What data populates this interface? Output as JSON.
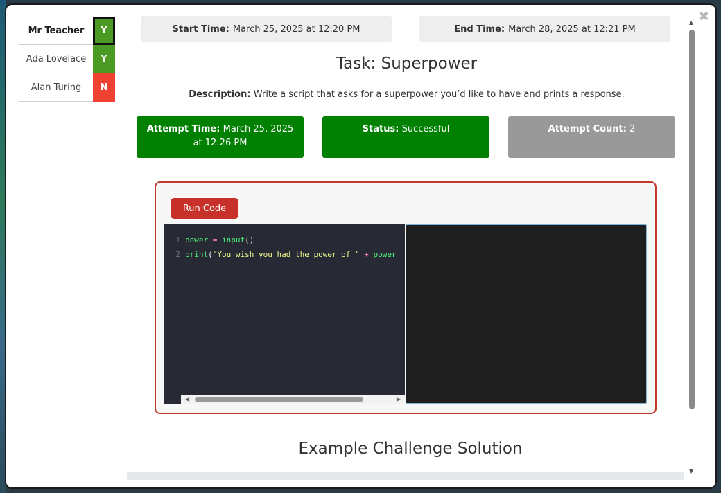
{
  "students": [
    {
      "name": "Mr Teacher",
      "badge": "Y",
      "current": true
    },
    {
      "name": "Ada Lovelace",
      "badge": "Y",
      "current": false
    },
    {
      "name": "Alan Turing",
      "badge": "N",
      "current": false
    }
  ],
  "times": {
    "start_label": "Start Time:",
    "start_value": "March 25, 2025 at 12:20 PM",
    "end_label": "End Time:",
    "end_value": "March 28, 2025 at 12:21 PM"
  },
  "task": {
    "title": "Task: Superpower",
    "description_label": "Description:",
    "description": "Write a script that asks for a superpower you’d like to have and prints a response."
  },
  "stats": {
    "attempt_time_label": "Attempt Time:",
    "attempt_time_value": "March 25, 2025 at 12:26 PM",
    "status_label": "Status:",
    "status_value": "Successful",
    "attempt_count_label": "Attempt Count:",
    "attempt_count_value": "2"
  },
  "editor": {
    "run_label": "Run Code",
    "lines": [
      {
        "no": "1",
        "tokens": [
          "power",
          " = ",
          "input",
          "()"
        ]
      },
      {
        "no": "2",
        "tokens": [
          "print",
          "(",
          "\"You wish you had the power of \"",
          " + ",
          "power"
        ]
      }
    ]
  },
  "example": {
    "title": "Example Challenge Solution"
  },
  "icons": {
    "close": "close-icon",
    "scroll_up": "scroll-up-icon",
    "scroll_down": "scroll-down-icon"
  },
  "colors": {
    "badge_yes": "#4a9a23",
    "badge_no": "#ee4131",
    "success": "#008000",
    "neutral": "#999999",
    "run_button": "#c8312a"
  }
}
